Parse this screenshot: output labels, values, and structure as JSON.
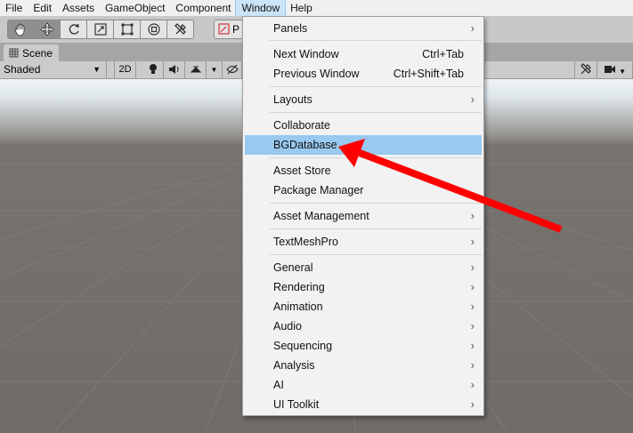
{
  "menubar": {
    "items": [
      "File",
      "Edit",
      "Assets",
      "GameObject",
      "Component",
      "Window",
      "Help"
    ],
    "active_index": 5
  },
  "toolbar": {
    "tools": [
      "hand-icon",
      "move-icon",
      "rotate-icon",
      "scale-icon",
      "rect-icon",
      "transform-icon",
      "custom-tool-icon"
    ],
    "pivot_label": "P"
  },
  "scene_tab": {
    "label": "Scene"
  },
  "scene_bar": {
    "shading": "Shaded",
    "mode_2d": "2D"
  },
  "window_menu": {
    "items": [
      {
        "label": "Panels",
        "shortcut": "",
        "submenu": true
      },
      {
        "label": "Next Window",
        "shortcut": "Ctrl+Tab",
        "submenu": false
      },
      {
        "label": "Previous Window",
        "shortcut": "Ctrl+Shift+Tab",
        "submenu": false
      },
      {
        "label": "Layouts",
        "shortcut": "",
        "submenu": true
      },
      {
        "label": "Collaborate",
        "shortcut": "",
        "submenu": false
      },
      {
        "label": "BGDatabase",
        "shortcut": "",
        "submenu": false,
        "highlighted": true
      },
      {
        "label": "Asset Store",
        "shortcut": "",
        "submenu": false
      },
      {
        "label": "Package Manager",
        "shortcut": "",
        "submenu": false
      },
      {
        "label": "Asset Management",
        "shortcut": "",
        "submenu": true
      },
      {
        "label": "TextMeshPro",
        "shortcut": "",
        "submenu": true
      },
      {
        "label": "General",
        "shortcut": "",
        "submenu": true
      },
      {
        "label": "Rendering",
        "shortcut": "",
        "submenu": true
      },
      {
        "label": "Animation",
        "shortcut": "",
        "submenu": true
      },
      {
        "label": "Audio",
        "shortcut": "",
        "submenu": true
      },
      {
        "label": "Sequencing",
        "shortcut": "",
        "submenu": true
      },
      {
        "label": "Analysis",
        "shortcut": "",
        "submenu": true
      },
      {
        "label": "AI",
        "shortcut": "",
        "submenu": true
      },
      {
        "label": "UI Toolkit",
        "shortcut": "",
        "submenu": true
      }
    ]
  },
  "annotation": {
    "arrow_color": "#ff0000"
  }
}
